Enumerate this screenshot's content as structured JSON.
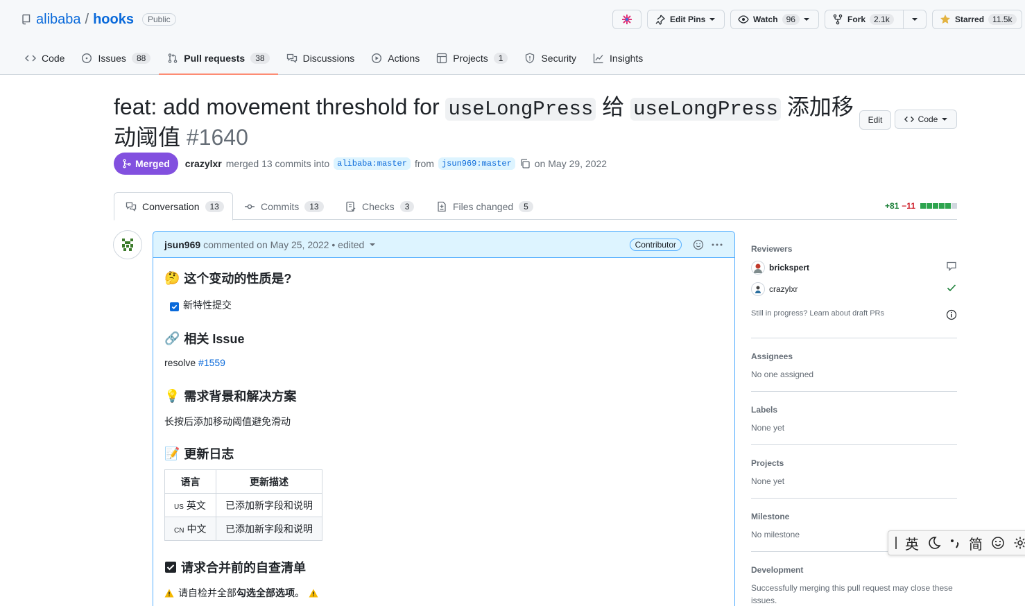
{
  "repo": {
    "owner": "alibaba",
    "separator": "/",
    "name": "hooks",
    "visibility": "Public"
  },
  "actions": {
    "edit_pins": "Edit Pins",
    "watch_label": "Watch",
    "watch_count": "96",
    "fork_label": "Fork",
    "fork_count": "2.1k",
    "starred_label": "Starred",
    "star_count": "11.5k"
  },
  "nav": [
    {
      "label": "Code",
      "count": ""
    },
    {
      "label": "Issues",
      "count": "88"
    },
    {
      "label": "Pull requests",
      "count": "38"
    },
    {
      "label": "Discussions",
      "count": ""
    },
    {
      "label": "Actions",
      "count": ""
    },
    {
      "label": "Projects",
      "count": "1"
    },
    {
      "label": "Security",
      "count": ""
    },
    {
      "label": "Insights",
      "count": ""
    }
  ],
  "pr": {
    "title_part1": "feat: add movement threshold for ",
    "title_code1": "useLongPress",
    "title_part2": " 给 ",
    "title_code2": "useLongPress",
    "title_part3": " 添加移动阈值",
    "number": "#1640",
    "edit_label": "Edit",
    "code_label": "Code",
    "status": "Merged",
    "author": "crazylxr",
    "merged_text": "merged 13 commits into",
    "base_branch": "alibaba:master",
    "from_text": "from",
    "head_branch": "jsun969:master",
    "date_text": "on May 29, 2022"
  },
  "tabs": [
    {
      "label": "Conversation",
      "count": "13"
    },
    {
      "label": "Commits",
      "count": "13"
    },
    {
      "label": "Checks",
      "count": "3"
    },
    {
      "label": "Files changed",
      "count": "5"
    }
  ],
  "diff": {
    "additions": "+81",
    "deletions": "−11",
    "add_color": "#2da44e",
    "del_color": "#cf222e"
  },
  "comment": {
    "author": "jsun969",
    "meta": "commented on May 25, 2022 • edited",
    "role": "Contributor",
    "sections": {
      "nature_emoji": "🤔",
      "nature_title": "这个变动的性质是?",
      "nature_item": "新特性提交",
      "issue_emoji": "🔗",
      "issue_title": "相关 Issue",
      "issue_prefix": "resolve",
      "issue_link": "#1559",
      "background_emoji": "💡",
      "background_title": "需求背景和解决方案",
      "background_text": "长按后添加移动阈值避免滑动",
      "changelog_emoji": "📝",
      "changelog_title": "更新日志",
      "checklist_emoji": "☑",
      "checklist_title": "请求合并前的自查清单",
      "warning_emoji": "⚠️",
      "warning_text_1": "请自检并全部",
      "warning_text_bold": "勾选全部选项",
      "warning_text_2": "。"
    },
    "table": {
      "headers": [
        "语言",
        "更新描述"
      ],
      "rows": [
        {
          "flag": "US",
          "lang": "英文",
          "desc": "已添加新字段和说明"
        },
        {
          "flag": "CN",
          "lang": "中文",
          "desc": "已添加新字段和说明"
        }
      ]
    }
  },
  "sidebar": {
    "reviewers_title": "Reviewers",
    "reviewers": [
      {
        "name": "brickspert",
        "status": "commented"
      },
      {
        "name": "crazylxr",
        "status": "approved"
      }
    ],
    "draft_hint": "Still in progress? Learn about draft PRs",
    "assignees_title": "Assignees",
    "assignees_value": "No one assigned",
    "labels_title": "Labels",
    "labels_value": "None yet",
    "projects_title": "Projects",
    "projects_value": "None yet",
    "milestone_title": "Milestone",
    "milestone_value": "No milestone",
    "development_title": "Development",
    "development_value": "Successfully merging this pull request may close these issues."
  },
  "ime": {
    "lang": "英",
    "mode": "简"
  },
  "colors": {
    "accent": "#0969da",
    "merged": "#8250df",
    "active_tab_underline": "#fd8c73"
  }
}
